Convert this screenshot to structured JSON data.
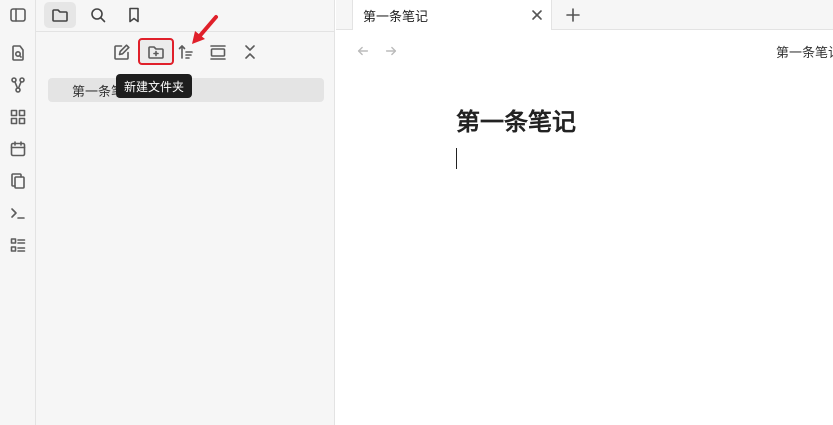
{
  "ribbon": {
    "icons": [
      "sidebar-toggle-icon",
      "file-search-icon",
      "graph-icon",
      "grid-icon",
      "calendar-icon",
      "copy-icon",
      "terminal-icon",
      "list-icon"
    ]
  },
  "sidebar": {
    "tabs": [
      "folder-icon",
      "search-icon",
      "bookmark-icon"
    ],
    "actions": [
      "new-note-icon",
      "new-folder-icon",
      "sort-icon",
      "view-icon",
      "collapse-icon"
    ],
    "tooltip": "新建文件夹",
    "files": [
      {
        "name": "第一条笔记"
      }
    ]
  },
  "main": {
    "tab": {
      "label": "第一条笔记"
    },
    "view_title": "第一条笔记",
    "doc_title": "第一条笔记"
  },
  "colors": {
    "highlight": "#e0202a",
    "tooltip_bg": "#1e1e1e",
    "sidebar_bg": "#f6f6f6"
  }
}
